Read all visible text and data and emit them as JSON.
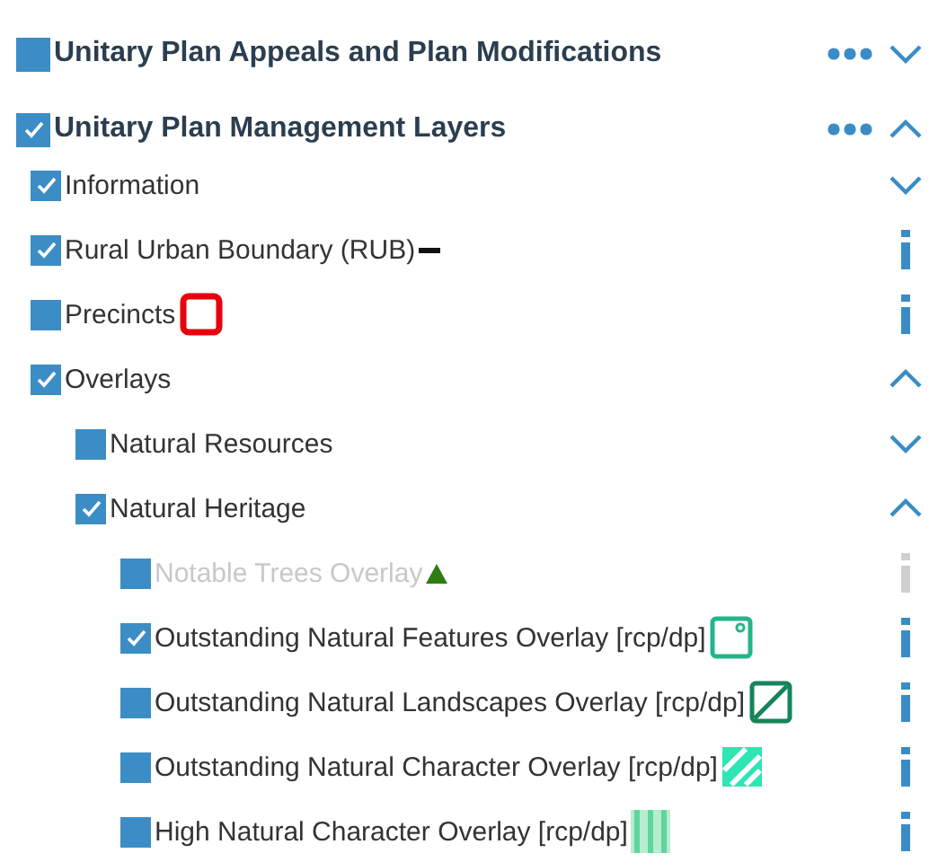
{
  "layers": [
    {
      "kind": "service",
      "label": "Unitary Plan Appeals and Plan Modifications",
      "checked": false,
      "expanded": false
    },
    {
      "kind": "service",
      "label": "Unitary Plan Management Layers",
      "checked": true,
      "expanded": true,
      "children": [
        {
          "kind": "group",
          "label": "Information",
          "checked": true,
          "expanded": false
        },
        {
          "kind": "layer",
          "label": "Rural Urban Boundary (RUB)",
          "checked": true,
          "disabled": false,
          "symbol": {
            "kind": "line"
          }
        },
        {
          "kind": "layer",
          "label": "Precincts",
          "checked": false,
          "disabled": false,
          "symbol": {
            "kind": "outline-square"
          }
        },
        {
          "kind": "group",
          "label": "Overlays",
          "checked": true,
          "expanded": true,
          "children": [
            {
              "kind": "group",
              "label": "Natural Resources",
              "checked": false,
              "expanded": false
            },
            {
              "kind": "group",
              "label": "Natural Heritage",
              "checked": true,
              "expanded": true,
              "children": [
                {
                  "kind": "layer",
                  "label": "Notable Trees Overlay",
                  "checked": false,
                  "disabled": true,
                  "symbol": {
                    "kind": "triangle"
                  }
                },
                {
                  "kind": "layer",
                  "label": "Outstanding Natural Features Overlay [rcp/dp]",
                  "checked": true,
                  "disabled": false,
                  "symbol": {
                    "kind": "dot-square"
                  }
                },
                {
                  "kind": "layer",
                  "label": "Outstanding Natural Landscapes Overlay [rcp/dp]",
                  "checked": false,
                  "disabled": false,
                  "symbol": {
                    "kind": "diagonal-square"
                  }
                },
                {
                  "kind": "layer",
                  "label": "Outstanding Natural Character Overlay [rcp/dp]",
                  "checked": false,
                  "disabled": false,
                  "symbol": {
                    "kind": "hatched-square"
                  }
                },
                {
                  "kind": "layer",
                  "label": "High Natural Character Overlay [rcp/dp]",
                  "checked": false,
                  "disabled": false,
                  "symbol": {
                    "kind": "striped-square"
                  }
                }
              ]
            }
          ]
        }
      ]
    }
  ]
}
